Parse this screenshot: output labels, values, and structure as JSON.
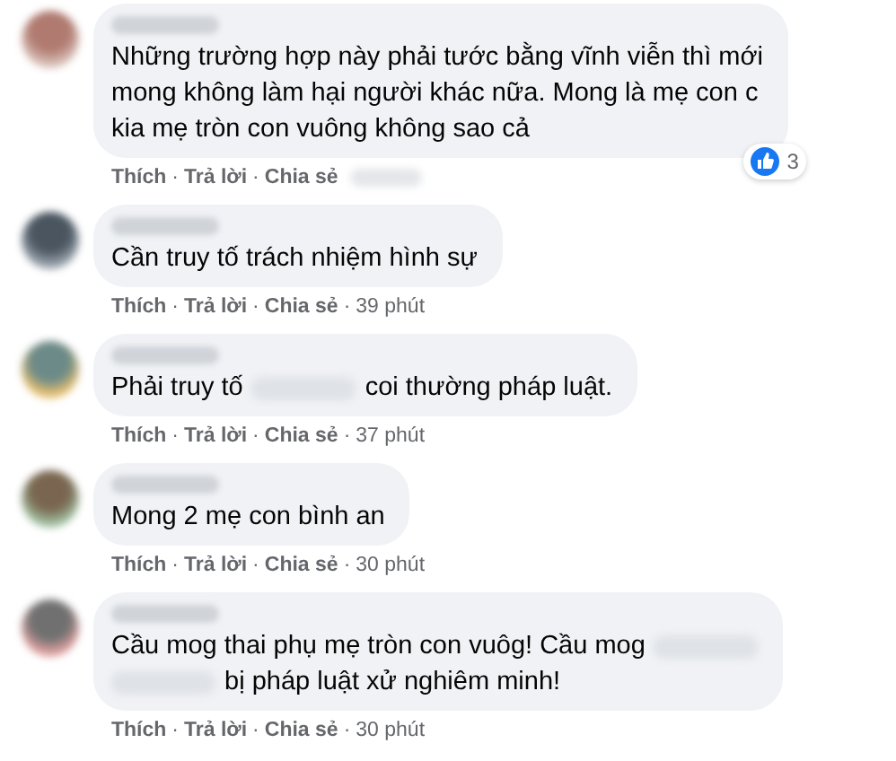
{
  "comments": [
    {
      "lines": [
        [
          {
            "kind": "text",
            "text": "Những trường hợp này phải tước bằng vĩnh viễn thì mới"
          }
        ],
        [
          {
            "kind": "text",
            "text": "mong không làm hại người khác nữa. Mong là mẹ con c"
          }
        ],
        [
          {
            "kind": "text",
            "text": "kia mẹ tròn con vuông không sao cả"
          }
        ]
      ],
      "footer": [
        {
          "kind": "action",
          "text": "Thích"
        },
        {
          "kind": "separator",
          "text": "·"
        },
        {
          "kind": "action",
          "text": "Trả lời"
        },
        {
          "kind": "separator",
          "text": "·"
        },
        {
          "kind": "action",
          "text": "Chia sẻ"
        },
        {
          "kind": "blur"
        }
      ],
      "reactions": "3"
    },
    {
      "lines": [
        [
          {
            "kind": "text",
            "text": "Cần truy tố trách nhiệm hình sự"
          }
        ]
      ],
      "footer": [
        {
          "kind": "action",
          "text": "Thích"
        },
        {
          "kind": "separator",
          "text": "·"
        },
        {
          "kind": "action",
          "text": "Trả lời"
        },
        {
          "kind": "separator",
          "text": "·"
        },
        {
          "kind": "action",
          "text": "Chia sẻ"
        },
        {
          "kind": "separator",
          "text": "·"
        },
        {
          "kind": "time",
          "text": "39 phút"
        }
      ]
    },
    {
      "lines": [
        [
          {
            "kind": "text",
            "text": "Phải truy tố"
          },
          {
            "kind": "blur"
          },
          {
            "kind": "text",
            "text": "coi thường pháp luật."
          }
        ]
      ],
      "footer": [
        {
          "kind": "action",
          "text": "Thích"
        },
        {
          "kind": "separator",
          "text": "·"
        },
        {
          "kind": "action",
          "text": "Trả lời"
        },
        {
          "kind": "separator",
          "text": "·"
        },
        {
          "kind": "action",
          "text": "Chia sẻ"
        },
        {
          "kind": "separator",
          "text": "·"
        },
        {
          "kind": "time",
          "text": "37 phút"
        }
      ]
    },
    {
      "lines": [
        [
          {
            "kind": "text",
            "text": "Mong 2 mẹ con bình an"
          }
        ]
      ],
      "footer": [
        {
          "kind": "action",
          "text": "Thích"
        },
        {
          "kind": "separator",
          "text": "·"
        },
        {
          "kind": "action",
          "text": "Trả lời"
        },
        {
          "kind": "separator",
          "text": "·"
        },
        {
          "kind": "action",
          "text": "Chia sẻ"
        },
        {
          "kind": "separator",
          "text": "·"
        },
        {
          "kind": "time",
          "text": "30 phút"
        }
      ]
    },
    {
      "lines": [
        [
          {
            "kind": "text",
            "text": "Cầu mog thai phụ mẹ tròn con vuôg! Cầu mog"
          },
          {
            "kind": "blur"
          }
        ],
        [
          {
            "kind": "blur"
          },
          {
            "kind": "text",
            "text": "bị pháp luật xử nghiêm minh!"
          }
        ]
      ],
      "footer": [
        {
          "kind": "action",
          "text": "Thích"
        },
        {
          "kind": "separator",
          "text": "·"
        },
        {
          "kind": "action",
          "text": "Trả lời"
        },
        {
          "kind": "separator",
          "text": "·"
        },
        {
          "kind": "action",
          "text": "Chia sẻ"
        },
        {
          "kind": "separator",
          "text": "·"
        },
        {
          "kind": "time",
          "text": "30 phút"
        }
      ]
    }
  ]
}
